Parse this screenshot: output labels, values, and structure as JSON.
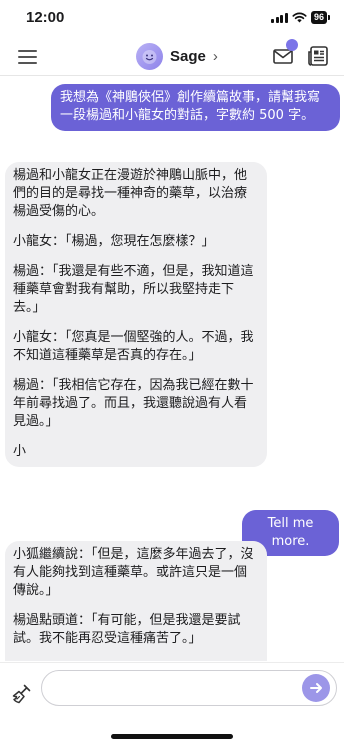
{
  "status_bar": {
    "time": "12:00",
    "battery": "96"
  },
  "header": {
    "bot_name": "Sage",
    "chevron": "›",
    "inbox_badge": "",
    "icons": {
      "menu": "hamburger-menu-icon",
      "avatar": "sage-avatar",
      "inbox": "envelope-icon",
      "news": "newspaper-icon"
    }
  },
  "conversation": {
    "messages": [
      {
        "sender": "user",
        "paragraphs": [
          "我想為《神鵰俠侶》創作續篇故事，請幫我寫一段楊過和小龍女的對話，字數約 500 字。"
        ]
      },
      {
        "sender": "bot",
        "paragraphs": [
          "楊過和小龍女正在漫遊於神鵰山脈中，他們的目的是尋找一種神奇的藥草，以治療楊過受傷的心。",
          "小龍女：「楊過，您現在怎麼樣？」",
          "楊過：「我還是有些不適，但是，我知道這種藥草會對我有幫助，所以我堅持走下去。」",
          "小龍女：「您真是一個堅強的人。不過，我不知道這種藥草是否真的存在。」",
          "楊過：「我相信它存在，因為我已經在數十年前尋找過了。而且，我還聽說過有人看見過。」",
          "小"
        ]
      },
      {
        "sender": "user",
        "paragraphs": [
          "Tell me more."
        ]
      },
      {
        "sender": "bot",
        "paragraphs": [
          "小狐繼續說：「但是，這麼多年過去了，沒有人能夠找到這種藥草。或許這只是一個傳說。」",
          "楊過點頭道：「有可能，但是我還是要試試。我不能再忍受這種痛苦了。」"
        ]
      }
    ]
  },
  "composer": {
    "input_value": "",
    "input_placeholder": "",
    "icons": {
      "clear": "broom-icon",
      "send": "arrow-right-icon"
    }
  },
  "colors": {
    "accent": "#6b62d6",
    "send_button": "#9c96e8",
    "bot_bubble": "#efeff1"
  }
}
